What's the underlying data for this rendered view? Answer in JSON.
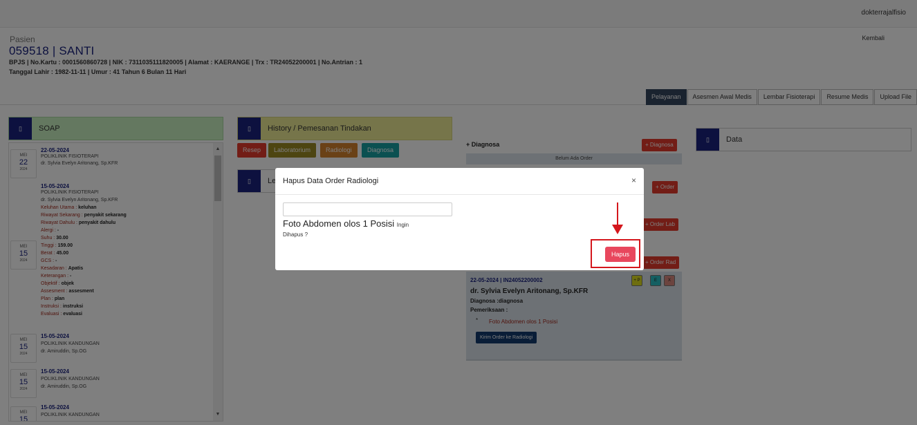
{
  "topbar": {
    "username": "dokterrajalfisio"
  },
  "patient": {
    "label": "Pasien",
    "title": "059518 | SANTI",
    "line1": "BPJS | No.Kartu : 0001560860728 | NIK : 7311035111820005 | Alamat : KAERANGE | Trx : TR24052200001 | No.Antrian : 1",
    "line2": "Tanggal Lahir : 1982-11-11 | Umur : 41 Tahun 6 Bulan 11 Hari",
    "back": "Kembali"
  },
  "tabs": [
    "Pelayanan",
    "Asesmen Awal Medis",
    "Lembar Fisioterapi",
    "Resume Medis",
    "Upload File"
  ],
  "soap": {
    "title": "SOAP",
    "icon": "square-icon",
    "items": [
      {
        "day": "22",
        "month": "MEI",
        "year": "2024",
        "date": "22-05-2024",
        "poli": "POLIKLINIK FISIOTERAPI",
        "doctor": "dr. Sylvia Evelyn Aritonang, Sp.KFR"
      },
      {
        "day": "15",
        "month": "MEI",
        "year": "2024",
        "date": "15-05-2024",
        "poli": "POLIKLINIK FISIOTERAPI",
        "doctor": "dr. Sylvia Evelyn Aritonang, Sp.KFR",
        "fields": [
          {
            "k": "Keluhan Utama : ",
            "v": "keluhan"
          },
          {
            "k": "Riwayat Sekarang : ",
            "v": "penyakit sekarang"
          },
          {
            "k": "Riwayat Dahulu : ",
            "v": "penyakit dahulu"
          },
          {
            "k": "Alergi : ",
            "v": "-"
          },
          {
            "k": "Suhu : ",
            "v": "30.00"
          },
          {
            "k": "Tinggi : ",
            "v": "159.00"
          },
          {
            "k": "Berat : ",
            "v": "45.00"
          },
          {
            "k": "GCS : ",
            "v": "-"
          },
          {
            "k": "Kesadaran : ",
            "v": "Apatis"
          },
          {
            "k": "Keterangan : ",
            "v": "-"
          },
          {
            "k": "Objektif : ",
            "v": "objek"
          },
          {
            "k": "Assesment : ",
            "v": "assesment"
          },
          {
            "k": "Plan : ",
            "v": "plan"
          },
          {
            "k": "Instruksi : ",
            "v": "instruksi"
          },
          {
            "k": "Evaluasi : ",
            "v": "evaluasi"
          }
        ]
      },
      {
        "day": "15",
        "month": "MEI",
        "year": "2024",
        "date": "15-05-2024",
        "poli": "POLIKLINIK KANDUNGAN",
        "doctor": "dr. Amiruddin, Sp.OG"
      },
      {
        "day": "15",
        "month": "MEI",
        "year": "2024",
        "date": "15-05-2024",
        "poli": "POLIKLINIK KANDUNGAN",
        "doctor": "dr. Amiruddin, Sp.OG"
      },
      {
        "day": "15",
        "month": "MEI",
        "year": "2024",
        "date": "15-05-2024",
        "poli": "POLIKLINIK KANDUNGAN",
        "doctor": ""
      }
    ]
  },
  "history": {
    "title": "History / Pemesanan Tindakan",
    "buttons": [
      "Resep",
      "Laboratorium",
      "Radiologi",
      "Diagnosa"
    ],
    "second_title": "Le"
  },
  "diagnosa": {
    "label": "+ Diagnosa",
    "add_button": "+ Diagnosa",
    "empty": "Belum Ada Order",
    "order_button": "+ Order",
    "lab_button": "+ Order Lab",
    "rad_button": "+ Order Rad"
  },
  "order_card": {
    "date": "22-05-2024 | IN24052200002",
    "doctor": "dr. Sylvia Evelyn Aritonang, Sp.KFR",
    "diagnosa": "Diagnosa :diagnosa",
    "pemeriksaan": "Pemeriksaan :",
    "bullet": "*",
    "item": "Foto Abdomen olos 1 Posisi",
    "send_button": "Kirim Order ke Radiologi",
    "mini_buttons": [
      "+ P",
      "E",
      "X"
    ]
  },
  "data_panel": {
    "title": "Data"
  },
  "modal": {
    "title": "Hapus Data Order Radiologi",
    "close": "×",
    "message_main": "Foto Abdomen olos 1 Posisi",
    "message_small": "Ingin",
    "message_line2": "Dihapus ?",
    "confirm_button": "Hapus"
  },
  "colors": {
    "navy": "#1a237e",
    "red": "#e43b2c",
    "hapus": "#e8475d",
    "annotation": "#d4161c"
  }
}
